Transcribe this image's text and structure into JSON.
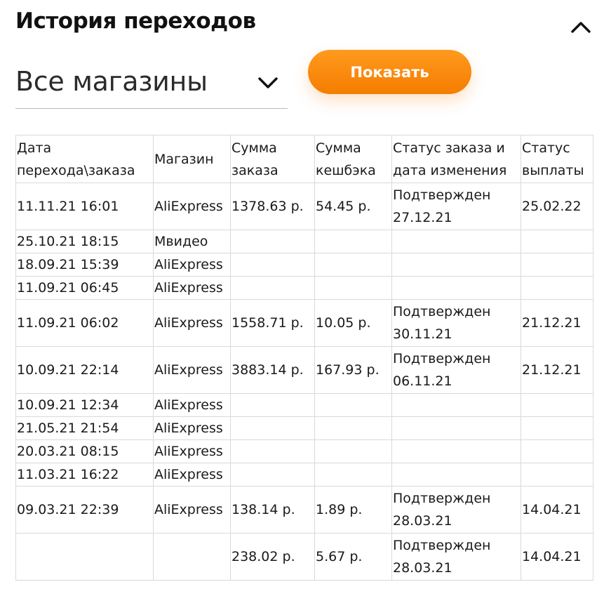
{
  "header": {
    "title": "История переходов"
  },
  "filter": {
    "store_value": "Все магазины",
    "show_button_label": "Показать"
  },
  "colors": {
    "accent": "#f5870f",
    "border": "#d9d9d9"
  },
  "icons": {
    "collapse": "chevron-up-icon",
    "dropdown": "chevron-down-icon"
  },
  "table": {
    "headers": [
      [
        "Дата",
        "перехода\\заказа"
      ],
      [
        "Магазин"
      ],
      [
        "Сумма",
        "заказа"
      ],
      [
        "Сумма",
        "кешбэка"
      ],
      [
        "Статус заказа и",
        "дата изменения"
      ],
      [
        "Статус",
        "выплаты"
      ]
    ],
    "rows": [
      [
        "11.11.21 16:01",
        "AliExpress",
        "1378.63 р.",
        "54.45 р.",
        "Подтвержден|27.12.21",
        "25.02.22"
      ],
      [
        "25.10.21 18:15",
        "Мвидео",
        "",
        "",
        "",
        ""
      ],
      [
        "18.09.21 15:39",
        "AliExpress",
        "",
        "",
        "",
        ""
      ],
      [
        "11.09.21 06:45",
        "AliExpress",
        "",
        "",
        "",
        ""
      ],
      [
        "11.09.21 06:02",
        "AliExpress",
        "1558.71 р.",
        "10.05 р.",
        "Подтвержден|30.11.21",
        "21.12.21"
      ],
      [
        "10.09.21 22:14",
        "AliExpress",
        "3883.14 р.",
        "167.93 р.",
        "Подтвержден|06.11.21",
        "21.12.21"
      ],
      [
        "10.09.21 12:34",
        "AliExpress",
        "",
        "",
        "",
        ""
      ],
      [
        "21.05.21 21:54",
        "AliExpress",
        "",
        "",
        "",
        ""
      ],
      [
        "20.03.21 08:15",
        "AliExpress",
        "",
        "",
        "",
        ""
      ],
      [
        "11.03.21 16:22",
        "AliExpress",
        "",
        "",
        "",
        ""
      ],
      [
        "09.03.21 22:39",
        "AliExpress",
        "138.14 р.",
        "1.89 р.",
        "Подтвержден|28.03.21",
        "14.04.21"
      ],
      [
        "",
        "",
        "238.02 р.",
        "5.67 р.",
        "Подтвержден|28.03.21",
        "14.04.21"
      ]
    ]
  }
}
